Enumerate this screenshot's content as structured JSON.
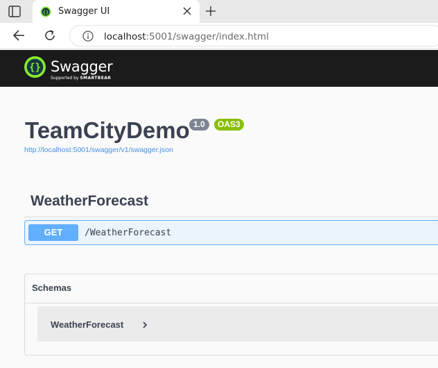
{
  "browser": {
    "tab_title": "Swagger UI",
    "url_host": "localhost",
    "url_path": ":5001/swagger/index.html"
  },
  "header": {
    "logo_text": "Swagger",
    "logo_tm": "™",
    "logo_sub_prefix": "Supported by ",
    "logo_sub_brand": "SMARTBEAR",
    "bg_color": "#1b1b1b",
    "logo_color": "#85ea2d"
  },
  "info": {
    "title": "TeamCityDemo",
    "version": "1.0",
    "oas_badge": "OAS3",
    "spec_url": "http://localhost:5001/swagger/v1/swagger.json"
  },
  "tag": {
    "name": "WeatherForecast",
    "operations": [
      {
        "method": "GET",
        "path": "/WeatherForecast",
        "color": "#61affe"
      }
    ]
  },
  "schemas": {
    "title": "Schemas",
    "items": [
      {
        "name": "WeatherForecast"
      }
    ]
  }
}
